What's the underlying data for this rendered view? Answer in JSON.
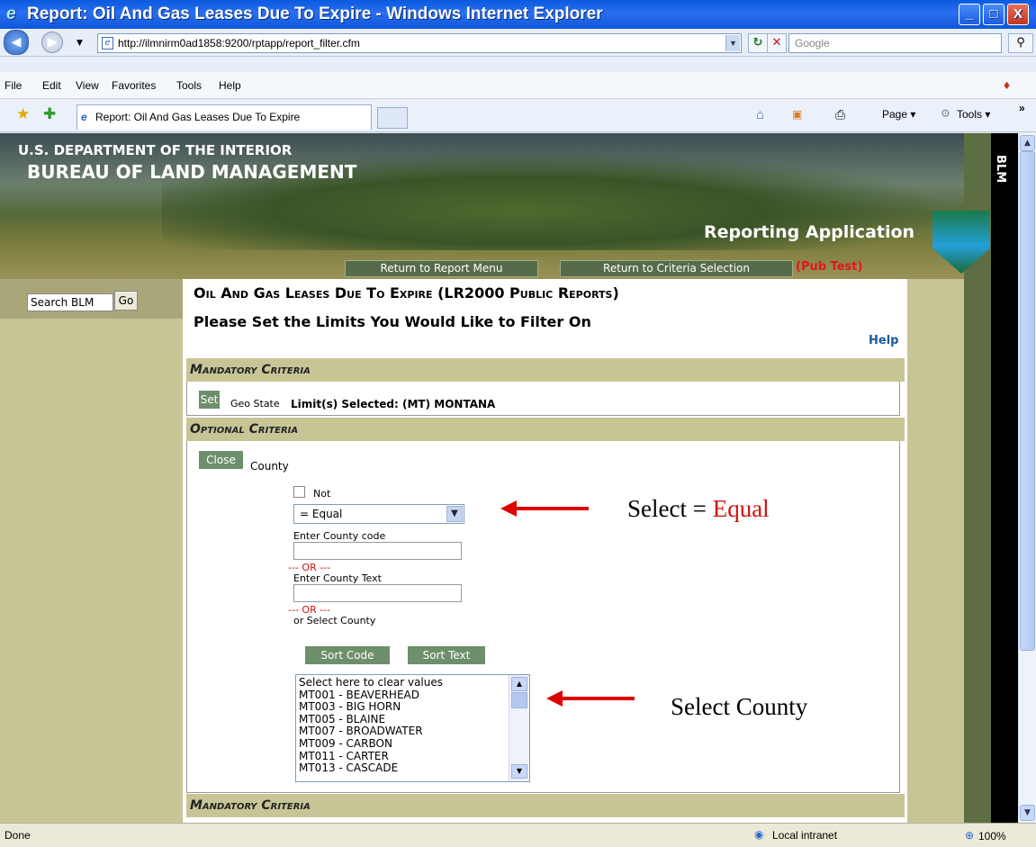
{
  "window": {
    "title": "Report: Oil And Gas Leases Due To Expire - Windows Internet Explorer",
    "min_label": "_",
    "max_label": "□",
    "close_label": "X"
  },
  "address": {
    "url": "http://ilmnirm0ad1858:9200/rptapp/report_filter.cfm",
    "search_placeholder": "Google"
  },
  "menu": [
    "File",
    "Edit",
    "View",
    "Favorites",
    "Tools",
    "Help"
  ],
  "tab": {
    "label": "Report: Oil And Gas Leases Due To Expire"
  },
  "cmdbar": {
    "page_label": "Page ▾",
    "tools_label": "Tools ▾"
  },
  "banner": {
    "dept": "U.S. DEPARTMENT OF THE INTERIOR",
    "bureau": "BUREAU OF LAND MANAGEMENT",
    "app": "Reporting Application",
    "blm": "BLM",
    "return_menu": "Return to Report Menu",
    "return_criteria": "Return to Criteria Selection",
    "pub_test": "(Pub Test)"
  },
  "sidebar": {
    "search_value": "Search BLM",
    "go_label": "Go"
  },
  "page": {
    "heading": "Oil And Gas Leases Due To Expire (LR2000 Public Reports)",
    "subheading": "Please Set the Limits You Would Like to Filter On",
    "help": "Help"
  },
  "mandatory": {
    "title": "Mandatory Criteria",
    "set_label": "Set",
    "field": "Geo State",
    "selected_label": "Limit(s) Selected: (MT) MONTANA"
  },
  "optional": {
    "title": "Optional Criteria",
    "close_label": "Close",
    "field": "County",
    "not_label": "Not",
    "operator": "=   Equal",
    "code_label": "Enter County code",
    "or1": "--- OR ---",
    "text_label": "Enter County Text",
    "or2": "--- OR ---",
    "select_label": "or Select County",
    "sort_code": "Sort Code",
    "sort_text": "Sort Text",
    "county_options": [
      "Select here to clear values",
      "MT001 - BEAVERHEAD",
      "MT003 - BIG HORN",
      "MT005 - BLAINE",
      "MT007 - BROADWATER",
      "MT009 - CARBON",
      "MT011 - CARTER",
      "MT013 - CASCADE"
    ]
  },
  "mandatory2": {
    "title": "Mandatory Criteria"
  },
  "annotations": {
    "select_prefix": "Select = ",
    "select_value": "Equal",
    "select_county": "Select County"
  },
  "status": {
    "done": "Done",
    "zone": "Local intranet",
    "zoom": "100%"
  }
}
